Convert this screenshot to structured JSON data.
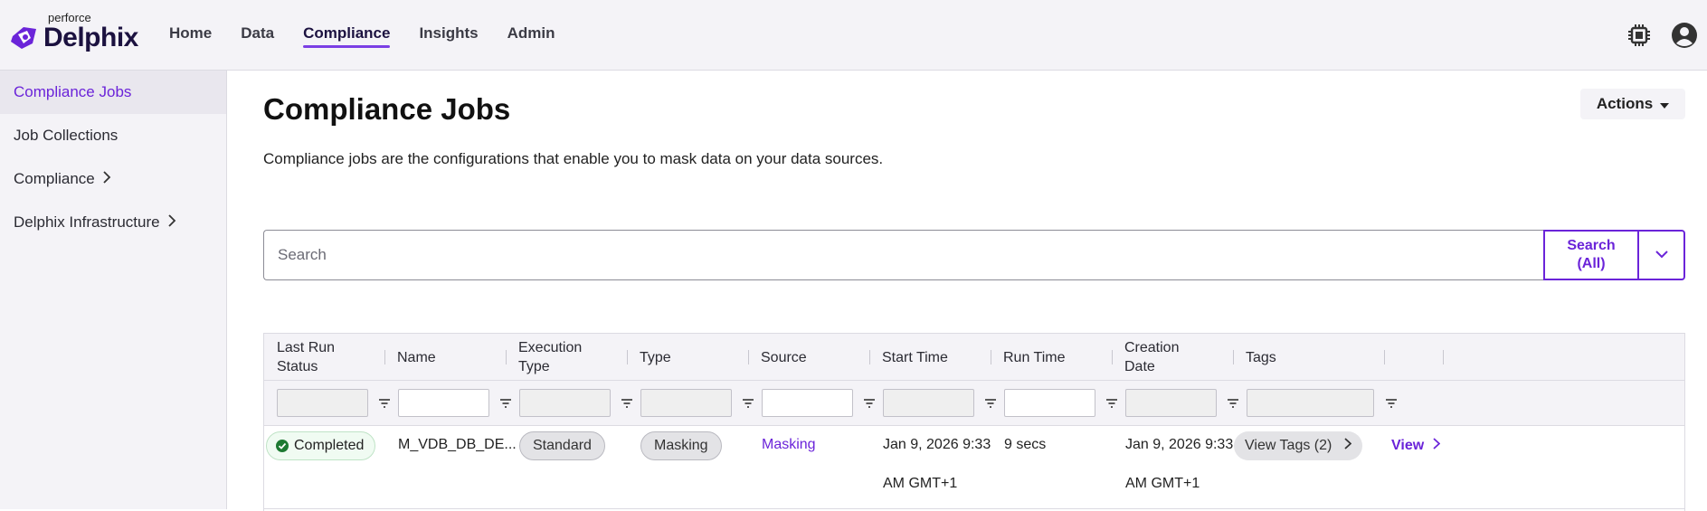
{
  "app": {
    "brand_small": "perforce",
    "brand_name": "Delphix"
  },
  "nav": {
    "items": [
      {
        "label": "Home",
        "active": false
      },
      {
        "label": "Data",
        "active": false
      },
      {
        "label": "Compliance",
        "active": true
      },
      {
        "label": "Insights",
        "active": false
      },
      {
        "label": "Admin",
        "active": false
      }
    ],
    "icons": [
      "cpu-chip-icon",
      "user-account-icon"
    ]
  },
  "sidebar": {
    "items": [
      {
        "label": "Compliance Jobs",
        "active": true,
        "has_children": false
      },
      {
        "label": "Job Collections",
        "active": false,
        "has_children": false
      },
      {
        "label": "Compliance",
        "active": false,
        "has_children": true
      },
      {
        "label": "Delphix Infrastructure",
        "active": false,
        "has_children": true
      }
    ]
  },
  "page": {
    "title": "Compliance Jobs",
    "description": "Compliance jobs are the configurations that enable you to mask data on your data sources.",
    "actions_label": "Actions"
  },
  "search": {
    "placeholder": "Search",
    "value": "",
    "button_line1": "Search",
    "button_line2": "(All)"
  },
  "table": {
    "columns": [
      {
        "line1": "Last Run",
        "line2": "Status"
      },
      {
        "line1": "Name",
        "line2": ""
      },
      {
        "line1": "Execution",
        "line2": "Type"
      },
      {
        "line1": "Type",
        "line2": ""
      },
      {
        "line1": "Source",
        "line2": ""
      },
      {
        "line1": "Start Time",
        "line2": ""
      },
      {
        "line1": "Run Time",
        "line2": ""
      },
      {
        "line1": "Creation",
        "line2": "Date"
      },
      {
        "line1": "Tags",
        "line2": ""
      }
    ],
    "rows": [
      {
        "status": "Completed",
        "name": "M_VDB_DB_DE...",
        "execution_type": "Standard",
        "type": "Masking",
        "source": "Masking",
        "start_time_line1": "Jan 9, 2026 9:33",
        "start_time_line2": "AM GMT+1",
        "run_time": "9 secs",
        "creation_line1": "Jan 9, 2026 9:33",
        "creation_line2": "AM GMT+1",
        "tags": "View Tags (2)",
        "view_label": "View"
      }
    ]
  },
  "colors": {
    "accent": "#6b24d9",
    "success": "#1e7a33",
    "chrome": "#f4f3f7"
  }
}
